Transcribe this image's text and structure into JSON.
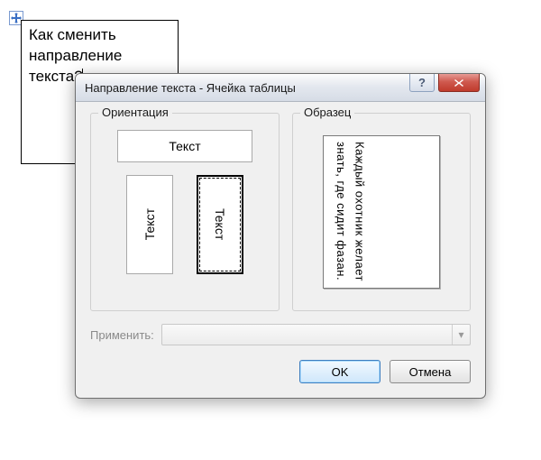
{
  "document": {
    "cell_text": "Как сменить направление текста?"
  },
  "dialog": {
    "title": "Направление текста - Ячейка таблицы",
    "help_symbol": "?",
    "groups": {
      "orientation_label": "Ориентация",
      "sample_label": "Образец"
    },
    "options": {
      "horizontal": "Текст",
      "vertical_left": "Текст",
      "vertical_right": "Текст"
    },
    "sample_text": "Каждый охотник желает знать, где сидит фазан.",
    "apply_label": "Применить:",
    "apply_value": "",
    "buttons": {
      "ok": "OK",
      "cancel": "Отмена"
    }
  }
}
